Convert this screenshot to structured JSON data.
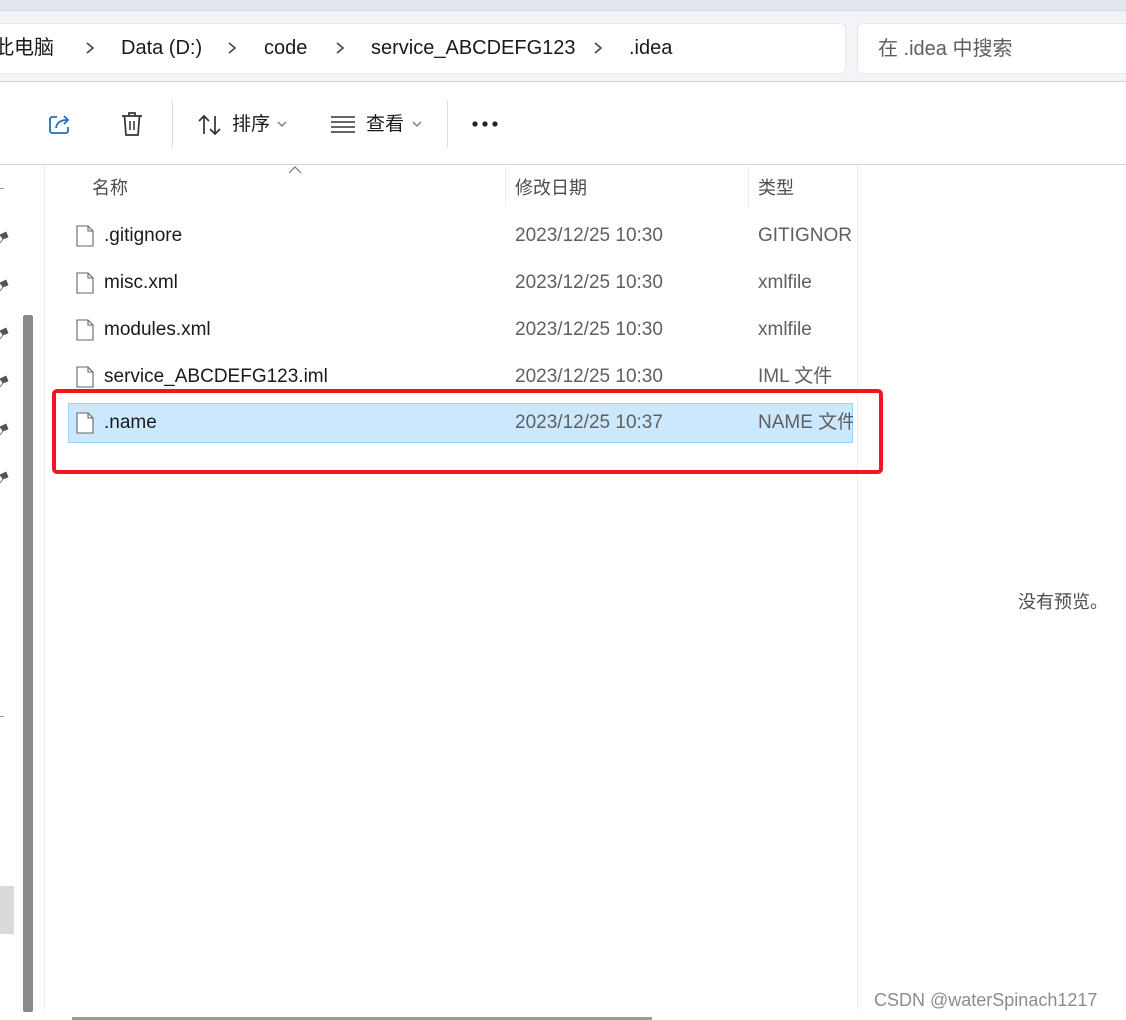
{
  "breadcrumb": {
    "items": [
      "此电脑",
      "Data (D:)",
      "code",
      "service_ABCDEFG123",
      ".idea"
    ]
  },
  "search": {
    "placeholder": "在 .idea 中搜索"
  },
  "toolbar": {
    "sort_label": "排序",
    "view_label": "查看",
    "share_icon": "share-icon",
    "delete_icon": "trash-icon",
    "more_icon": "more-icon"
  },
  "columns": {
    "name": "名称",
    "date": "修改日期",
    "type": "类型"
  },
  "files": [
    {
      "name": ".gitignore",
      "date": "2023/12/25 10:30",
      "type": "GITIGNORE"
    },
    {
      "name": "misc.xml",
      "date": "2023/12/25 10:30",
      "type": "xmlfile"
    },
    {
      "name": "modules.xml",
      "date": "2023/12/25 10:30",
      "type": "xmlfile"
    },
    {
      "name": "service_ABCDEFG123.iml",
      "date": "2023/12/25 10:30",
      "type": "IML 文件"
    },
    {
      "name": ".name",
      "date": "2023/12/25 10:37",
      "type": "NAME 文件"
    }
  ],
  "selected_file": ".name",
  "preview": {
    "text": "没有预览。"
  },
  "watermark": "CSDN @waterSpinach1217",
  "colors": {
    "selection": "#cce8ff",
    "selection_border": "#99d1ff",
    "highlight": "#f0151e",
    "accent_icon": "#1f6fc5"
  }
}
